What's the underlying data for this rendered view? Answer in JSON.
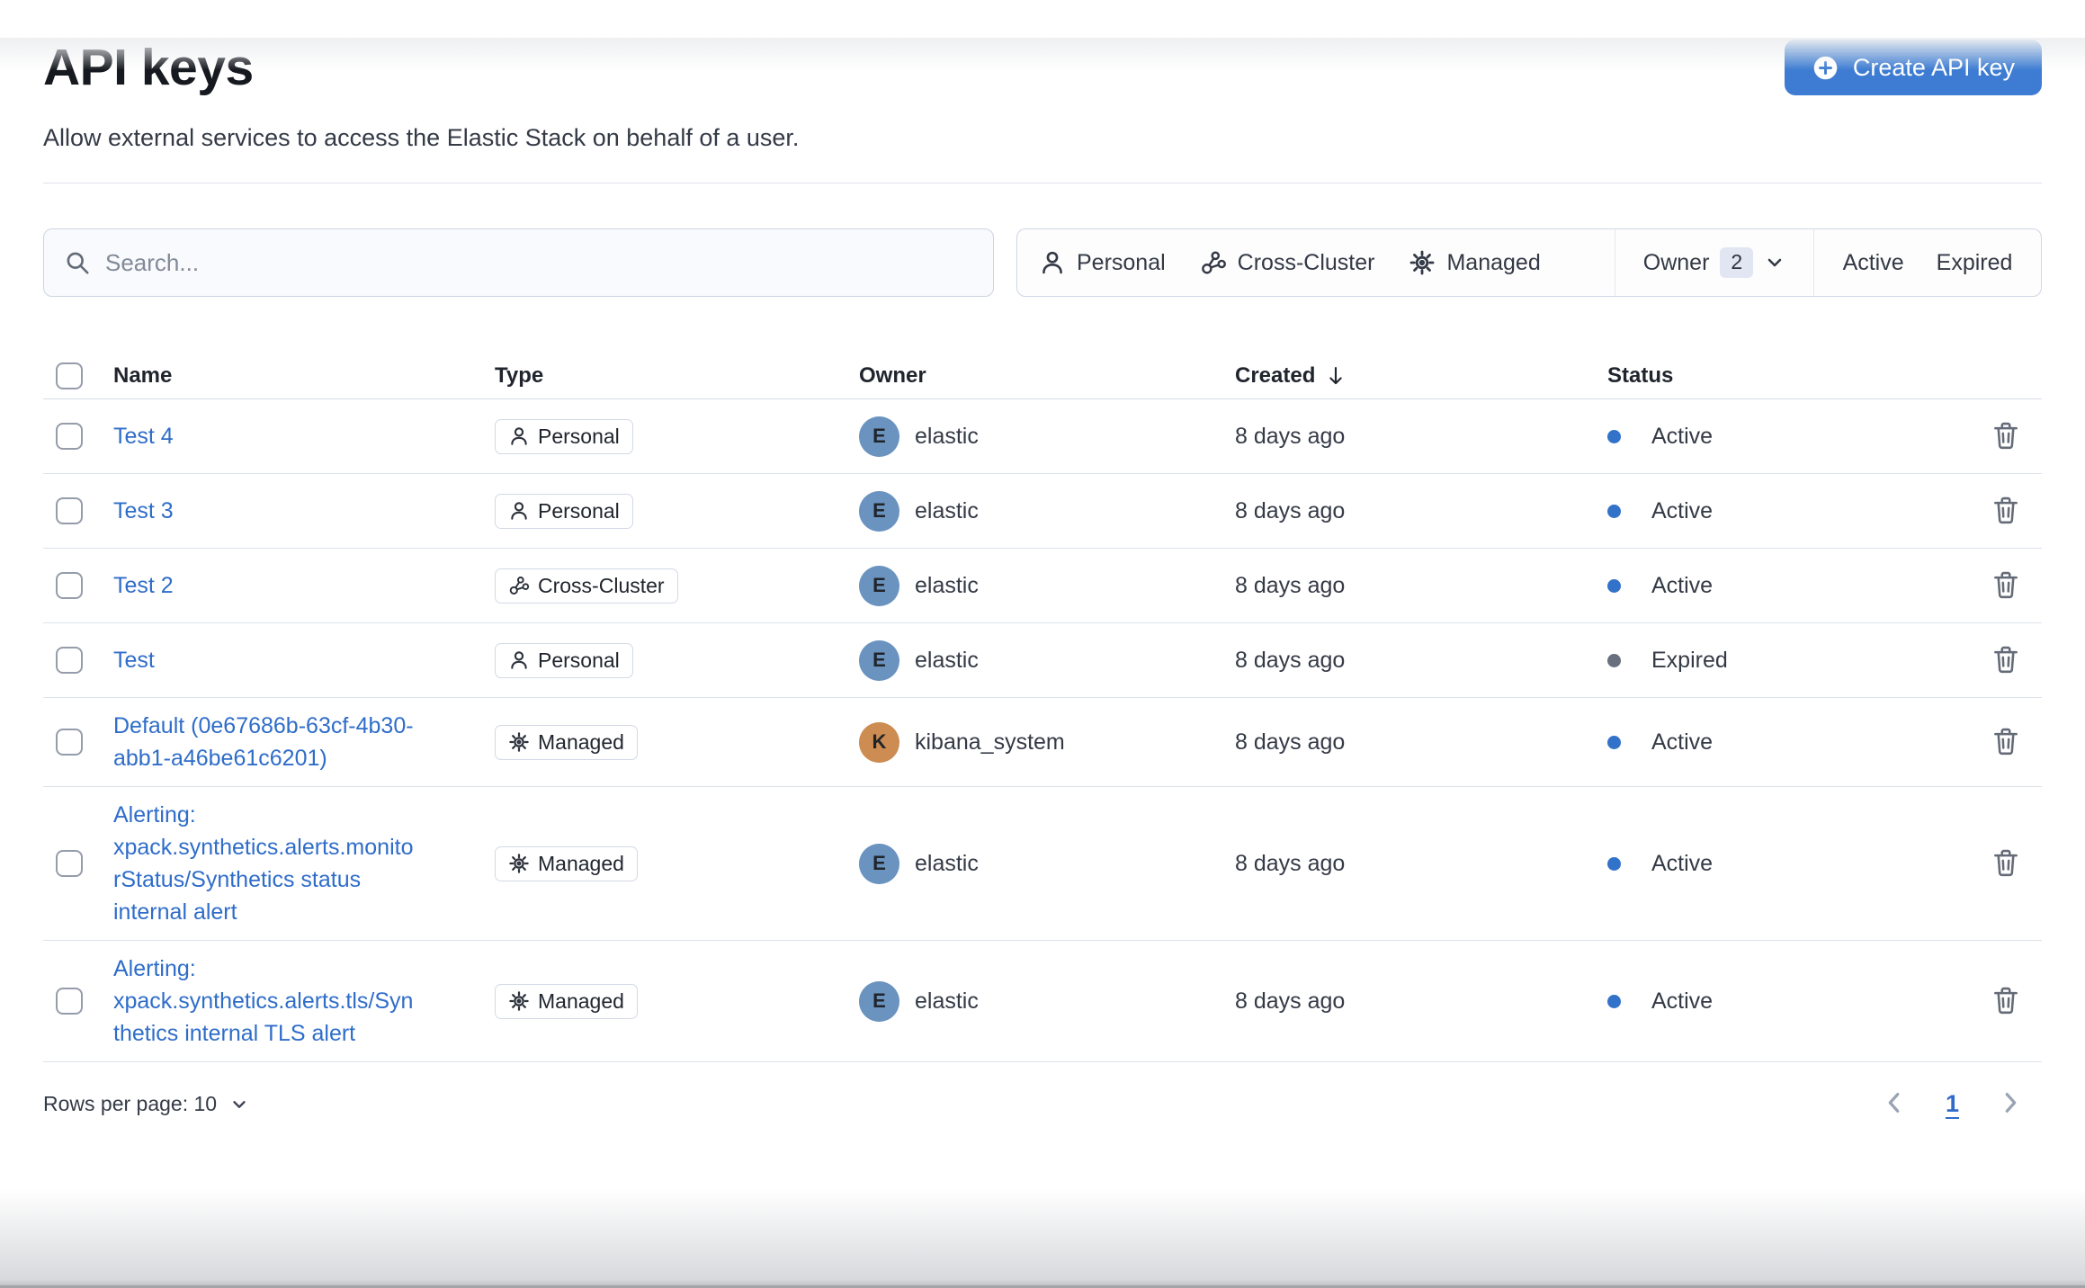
{
  "page": {
    "title": "API keys",
    "subtitle": "Allow external services to access the Elastic Stack on behalf of a user.",
    "create_button_label": "Create API key"
  },
  "toolbar": {
    "search_placeholder": "Search...",
    "filters": {
      "type_filters": [
        {
          "label": "Personal",
          "icon": "user-icon"
        },
        {
          "label": "Cross-Cluster",
          "icon": "cluster-icon"
        },
        {
          "label": "Managed",
          "icon": "gear-icon"
        }
      ],
      "owner_filter": {
        "label": "Owner",
        "count": "2",
        "icon": "chevron-down-icon"
      },
      "status_filters": [
        {
          "label": "Active"
        },
        {
          "label": "Expired"
        }
      ]
    }
  },
  "table": {
    "columns": [
      "Name",
      "Type",
      "Owner",
      "Created",
      "Status"
    ],
    "sorted_column": "Created",
    "sort_direction": "descending",
    "type_icons": {
      "Personal": "user",
      "Cross-Cluster": "cluster",
      "Managed": "gear"
    },
    "owners": {
      "elastic": {
        "initial": "E",
        "color": "#6a93c0"
      },
      "kibana_system": {
        "initial": "K",
        "color": "#cd8c51"
      }
    },
    "status_colors": {
      "Active": "#3272c9",
      "Expired": "#69707d"
    },
    "rows": [
      {
        "name": "Test 4",
        "type": "Personal",
        "owner": "elastic",
        "created": "8 days ago",
        "status": "Active"
      },
      {
        "name": "Test 3",
        "type": "Personal",
        "owner": "elastic",
        "created": "8 days ago",
        "status": "Active"
      },
      {
        "name": "Test 2",
        "type": "Cross-Cluster",
        "owner": "elastic",
        "created": "8 days ago",
        "status": "Active"
      },
      {
        "name": "Test",
        "type": "Personal",
        "owner": "elastic",
        "created": "8 days ago",
        "status": "Expired"
      },
      {
        "name": "Default (0e67686b-63cf-4b30-abb1-a46be61c6201)",
        "type": "Managed",
        "owner": "kibana_system",
        "created": "8 days ago",
        "status": "Active"
      },
      {
        "name": "Alerting: xpack.synthetics.alerts.monitorStatus/Synthetics status internal alert",
        "type": "Managed",
        "owner": "elastic",
        "created": "8 days ago",
        "status": "Active"
      },
      {
        "name": "Alerting: xpack.synthetics.alerts.tls/Synthetics internal TLS alert",
        "type": "Managed",
        "owner": "elastic",
        "created": "8 days ago",
        "status": "Active"
      }
    ]
  },
  "footer": {
    "rows_per_page_label": "Rows per page: 10",
    "page_number": "1"
  },
  "colors": {
    "primary_button": "#3d7cd2",
    "link": "#2f6dc9",
    "heading": "#16191f",
    "body_text": "#343a46"
  }
}
